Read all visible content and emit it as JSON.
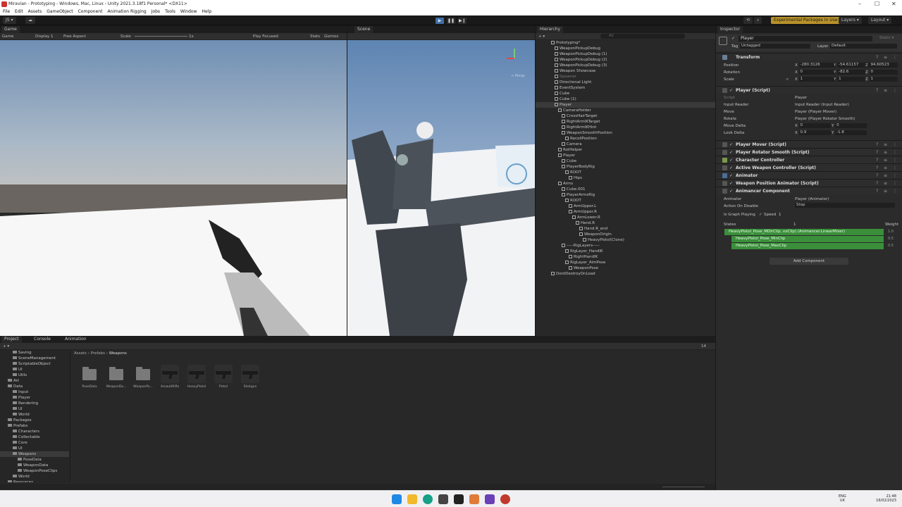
{
  "window": {
    "title": "Miravian - Prototyping - Windows, Mac, Linux - Unity 2021.3.18f1 Personal* <DX11>",
    "min": "–",
    "max": "☐",
    "close": "✕"
  },
  "menu": [
    "File",
    "Edit",
    "Assets",
    "GameObject",
    "Component",
    "Animation Rigging",
    "Jobs",
    "Tools",
    "Window",
    "Help"
  ],
  "toolbar": {
    "account": "JS ▾",
    "cloud": "☁",
    "play": "▶",
    "pause": "❚❚",
    "step": "▶❙",
    "history": "⟲",
    "search": "⌕",
    "packages": "Experimental Packages In Use ▾",
    "layers": "Layers ▾",
    "layout": "Layout ▾"
  },
  "game": {
    "tab": "Game",
    "display": "Game",
    "display_target": "Display 1",
    "aspect": "Free Aspect",
    "scale_label": "Scale",
    "scale_value": "1x",
    "play_focused": "Play Focused",
    "stats": "Stats",
    "gizmos": "Gizmos"
  },
  "scene": {
    "tab": "Scene",
    "persp": "< Persp"
  },
  "hierarchy": {
    "tab": "Hierarchy",
    "add": "+ ▾",
    "search_placeholder": "All",
    "rows": [
      {
        "label": "Prototyping*",
        "depth": 0,
        "root": true
      },
      {
        "label": "WeaponPickupDebug",
        "depth": 1
      },
      {
        "label": "WeaponPickupDebug (1)",
        "depth": 1
      },
      {
        "label": "WeaponPickupDebug (2)",
        "depth": 1
      },
      {
        "label": "WeaponPickupDebug (3)",
        "depth": 1
      },
      {
        "label": "Weapon Showcase",
        "depth": 1
      },
      {
        "label": "Spawner",
        "depth": 1,
        "dim": true
      },
      {
        "label": "Directional Light",
        "depth": 1
      },
      {
        "label": "EventSystem",
        "depth": 1
      },
      {
        "label": "Cube",
        "depth": 1
      },
      {
        "label": "Cube (1)",
        "depth": 1
      },
      {
        "label": "Player",
        "depth": 1,
        "selected": true
      },
      {
        "label": "CameraHolder",
        "depth": 2
      },
      {
        "label": "CrossHairTarget",
        "depth": 3
      },
      {
        "label": "RightArmIKTarget",
        "depth": 3
      },
      {
        "label": "RightArmIKHint",
        "depth": 3
      },
      {
        "label": "WeaponSmoothPosition",
        "depth": 3
      },
      {
        "label": "RecoilPosition",
        "depth": 4
      },
      {
        "label": "Camera",
        "depth": 3
      },
      {
        "label": "RotHelper",
        "depth": 2
      },
      {
        "label": "Player",
        "depth": 2
      },
      {
        "label": "Cube",
        "depth": 3
      },
      {
        "label": "PlayerBodyRig",
        "depth": 3
      },
      {
        "label": "ROOT",
        "depth": 4
      },
      {
        "label": "Hips",
        "depth": 5
      },
      {
        "label": "Arms",
        "depth": 2
      },
      {
        "label": "Cube.001",
        "depth": 3
      },
      {
        "label": "PlayerArmsRig",
        "depth": 3
      },
      {
        "label": "ROOT",
        "depth": 4
      },
      {
        "label": "ArmUpper.L",
        "depth": 5
      },
      {
        "label": "ArmUpper.R",
        "depth": 5
      },
      {
        "label": "ArmLower.R",
        "depth": 6
      },
      {
        "label": "Hand.R",
        "depth": 7
      },
      {
        "label": "Hand.R_end",
        "depth": 8
      },
      {
        "label": "WeaponOrigin",
        "depth": 8
      },
      {
        "label": "HeavyPistol(Clone)",
        "depth": 9
      },
      {
        "label": "-----RigLayers-----",
        "depth": 3
      },
      {
        "label": "RigLayer_HandIK",
        "depth": 4
      },
      {
        "label": "RightHandIK",
        "depth": 5
      },
      {
        "label": "RigLayer_AimPose",
        "depth": 4
      },
      {
        "label": "WeaponPose",
        "depth": 5
      },
      {
        "label": "DontDestroyOnLoad",
        "depth": 0,
        "root": true
      }
    ]
  },
  "inspector": {
    "tab": "Inspector",
    "name": "Player",
    "static": "Static ▾",
    "tag_label": "Tag",
    "tag": "Untagged",
    "layer_label": "Layer",
    "layer": "Default",
    "transform": {
      "title": "Transform",
      "position_label": "Position",
      "rotation_label": "Rotation",
      "scale_label": "Scale",
      "position": {
        "x": "-280.3126",
        "y": "-54.61157",
        "z": "94.60523"
      },
      "rotation": {
        "x": "0",
        "y": "-82.6",
        "z": "0"
      },
      "scale": {
        "x": "1",
        "y": "1",
        "z": "1"
      }
    },
    "player_script": {
      "title": "Player (Script)",
      "script_label": "Script",
      "script": "Player",
      "fields": [
        {
          "label": "Input Reader",
          "value": "Input Reader (Input Reader)"
        },
        {
          "label": "Move",
          "value": "Player (Player Mover)"
        },
        {
          "label": "Rotate",
          "value": "Player (Player Rotator Smooth)"
        }
      ],
      "move_delta_label": "Move Delta",
      "move_delta": {
        "x": "0",
        "y": "0"
      },
      "look_delta_label": "Look Delta",
      "look_delta": {
        "x": "0.9",
        "y": "-1.8"
      }
    },
    "components": [
      "Player Mover (Script)",
      "Player Rotator Smooth (Script)",
      "Character Controller",
      "Active Weapon Controller (Script)",
      "Animator",
      "Weapon Position Animator (Script)",
      "Animancer Component"
    ],
    "animancer": {
      "animator_label": "Animator",
      "animator": "Player (Animator)",
      "action_label": "Action On Disable",
      "action": "Stop",
      "graph_label": "Is Graph Playing",
      "speed_label": "Speed",
      "speed": "1",
      "states_label": "States",
      "states_count": "1",
      "weight_label": "Weight",
      "states": [
        {
          "label": "HeavyPistol_Pose_MDirClip, xxClip) (Animancer.LinearMixer)",
          "weight": "1.0"
        },
        {
          "label": "HeavyPistol_Pose_MinClip",
          "weight": "0.5"
        },
        {
          "label": "HeavyPistol_Pose_MaxClip",
          "weight": "0.5"
        }
      ]
    },
    "add_component": "Add Component"
  },
  "project": {
    "tabs": [
      "Project",
      "Console",
      "Animation"
    ],
    "add": "+ ▾",
    "breadcrumb": [
      "Assets",
      "Prefabs",
      "Weapons"
    ],
    "tree": [
      {
        "label": "Saving",
        "d": 2
      },
      {
        "label": "SceneManagement",
        "d": 2
      },
      {
        "label": "ScriptableObject",
        "d": 2
      },
      {
        "label": "UI",
        "d": 2
      },
      {
        "label": "Utils",
        "d": 2
      },
      {
        "label": "Art",
        "d": 1
      },
      {
        "label": "Data",
        "d": 1
      },
      {
        "label": "Input",
        "d": 2
      },
      {
        "label": "Player",
        "d": 2
      },
      {
        "label": "Rendering",
        "d": 2
      },
      {
        "label": "UI",
        "d": 2
      },
      {
        "label": "World",
        "d": 2
      },
      {
        "label": "Packages",
        "d": 1
      },
      {
        "label": "Prefabs",
        "d": 1
      },
      {
        "label": "Characters",
        "d": 2
      },
      {
        "label": "Collectable",
        "d": 2
      },
      {
        "label": "Core",
        "d": 2
      },
      {
        "label": "UI",
        "d": 2
      },
      {
        "label": "Weapons",
        "d": 2,
        "sel": true
      },
      {
        "label": "PoseData",
        "d": 3
      },
      {
        "label": "WeaponData",
        "d": 3
      },
      {
        "label": "WeaponPoseClips",
        "d": 3
      },
      {
        "label": "World",
        "d": 2
      },
      {
        "label": "Resources",
        "d": 1
      }
    ],
    "assets": [
      {
        "label": "PoseData",
        "kind": "folder"
      },
      {
        "label": "WeaponDa...",
        "kind": "folder"
      },
      {
        "label": "WeaponPo...",
        "kind": "folder"
      },
      {
        "label": "AssaultRifle",
        "kind": "gun"
      },
      {
        "label": "HeavyPistol",
        "kind": "gun"
      },
      {
        "label": "Pistol",
        "kind": "gun"
      },
      {
        "label": "Shotgun",
        "kind": "gun"
      }
    ],
    "count": "14"
  },
  "taskbar": {
    "lang": "ENG",
    "region": "UK",
    "time": "21:48",
    "date": "16/02/2023"
  },
  "colors": {
    "accent": "#3d6ea8",
    "play_active": "#3d6ea8",
    "packages_bg": "#b8912a",
    "state_green": "#3b8f3b",
    "selected": "#3a3a3a"
  }
}
